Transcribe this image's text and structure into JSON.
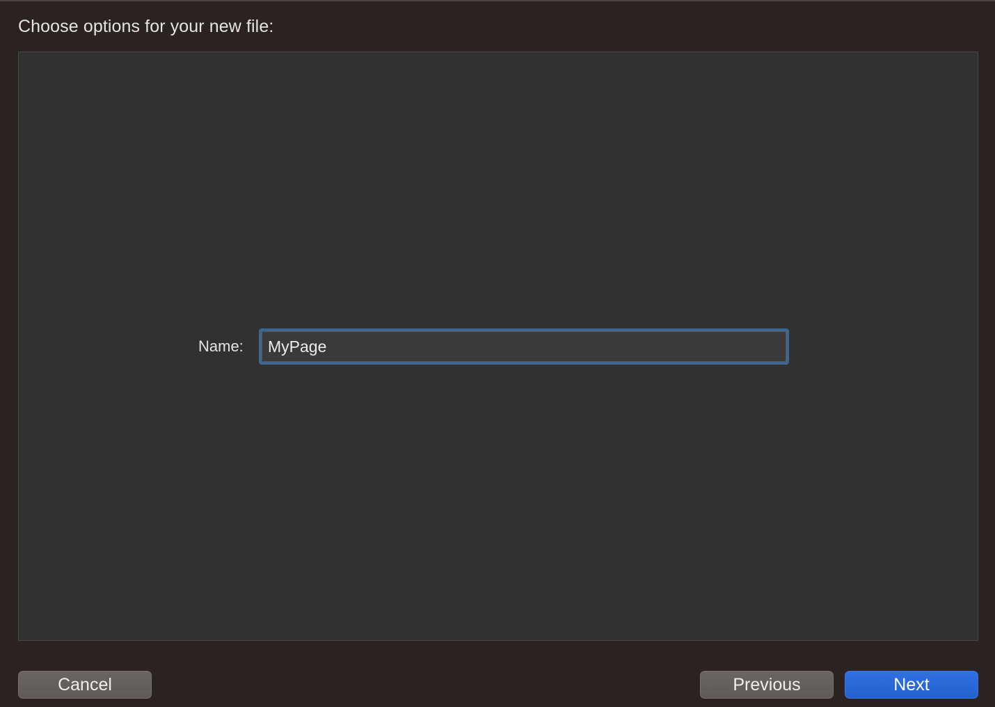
{
  "dialog": {
    "title": "Choose options for your new file:"
  },
  "form": {
    "name_label": "Name:",
    "name_value": "MyPage"
  },
  "buttons": {
    "cancel_label": "Cancel",
    "previous_label": "Previous",
    "next_label": "Next"
  },
  "colors": {
    "sheet_background": "#2b2321",
    "content_background": "#313131",
    "focus_ring": "#3e6691",
    "primary_button": "#2a68d8",
    "secondary_button": "#655f5d"
  }
}
